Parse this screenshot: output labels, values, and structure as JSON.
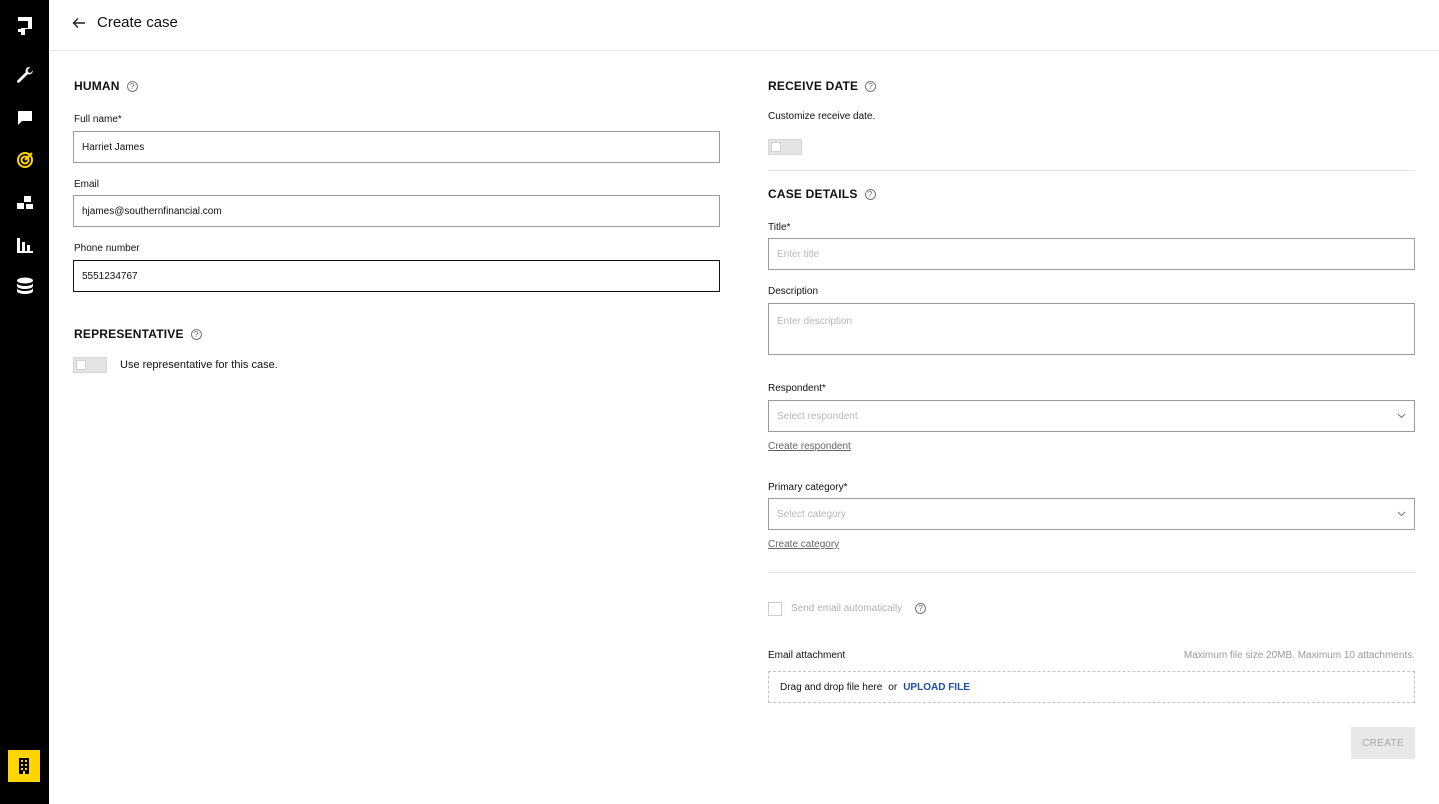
{
  "header": {
    "title": "Create case"
  },
  "human": {
    "section_title": "HUMAN",
    "full_name_label": "Full name*",
    "full_name_value": "Harriet James",
    "email_label": "Email",
    "email_value": "hjames@southernfinancial.com",
    "phone_label": "Phone number",
    "phone_value": "5551234767"
  },
  "representative": {
    "section_title": "REPRESENTATIVE",
    "toggle_label": "Use representative for this case."
  },
  "receive_date": {
    "section_title": "RECEIVE DATE",
    "description": "Customize receive date."
  },
  "case_details": {
    "section_title": "CASE DETAILS",
    "title_label": "Title*",
    "title_placeholder": "Enter title",
    "description_label": "Description",
    "description_placeholder": "Enter description",
    "respondent_label": "Respondent*",
    "respondent_placeholder": "Select respondent",
    "create_respondent_link": "Create respondent",
    "category_label": "Primary category*",
    "category_placeholder": "Select category",
    "create_category_link": "Create category",
    "send_email_label": "Send email automatically",
    "attachment_label": "Email attachment",
    "attachment_hint": "Maximum file size 20MB. Maximum 10 attachments.",
    "dropzone_text": "Drag and drop file here",
    "dropzone_or": "or",
    "upload_link": "UPLOAD FILE",
    "create_button": "CREATE"
  },
  "sidebar": {
    "items": [
      {
        "icon": "logo-icon"
      },
      {
        "icon": "wrench-icon"
      },
      {
        "icon": "chat-icon"
      },
      {
        "icon": "target-icon",
        "active": true
      },
      {
        "icon": "workflow-icon"
      },
      {
        "icon": "bar-chart-icon"
      },
      {
        "icon": "database-icon"
      }
    ],
    "org_icon": "building-icon"
  },
  "colors": {
    "accent": "#ffd400",
    "sidebar_bg": "#000000",
    "link_blue": "#1a4fa3",
    "disabled_button": "#e8e8e8"
  }
}
